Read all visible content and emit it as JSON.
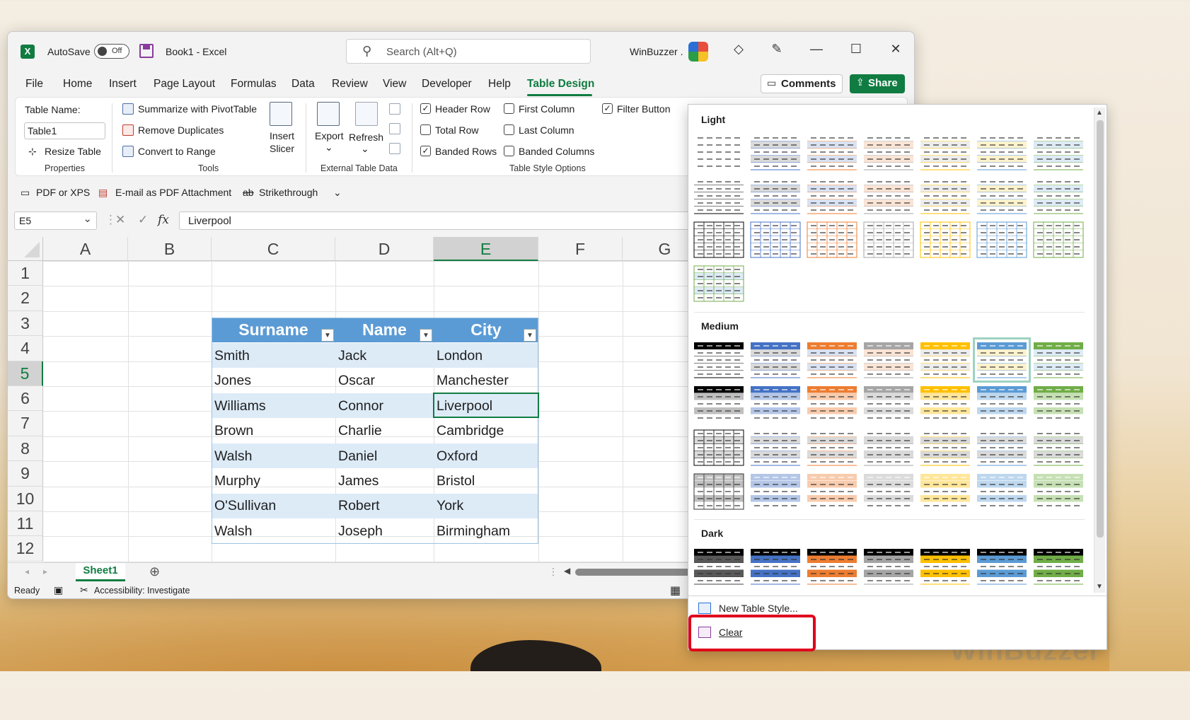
{
  "titlebar": {
    "autosave_label": "AutoSave",
    "autosave_state": "Off",
    "doc_title": "Book1  -  Excel",
    "search_placeholder": "Search (Alt+Q)",
    "user_name": "WinBuzzer ."
  },
  "menu": {
    "items": [
      "File",
      "Home",
      "Insert",
      "Page Layout",
      "Formulas",
      "Data",
      "Review",
      "View",
      "Developer",
      "Help",
      "Table Design"
    ],
    "active": "Table Design",
    "comments": "Comments",
    "share": "Share"
  },
  "ribbon": {
    "table_name_label": "Table Name:",
    "table_name_value": "Table1",
    "resize_table": "Resize Table",
    "properties_group": "Properties",
    "summarize_pivot": "Summarize with PivotTable",
    "remove_duplicates": "Remove Duplicates",
    "convert_range": "Convert to Range",
    "tools_group": "Tools",
    "insert_slicer_1": "Insert",
    "insert_slicer_2": "Slicer",
    "export": "Export",
    "refresh": "Refresh",
    "external_group": "External Table Data",
    "options": {
      "header_row": "Header Row",
      "total_row": "Total Row",
      "banded_rows": "Banded Rows",
      "first_column": "First Column",
      "last_column": "Last Column",
      "banded_columns": "Banded Columns",
      "filter_button": "Filter Button"
    },
    "checked": {
      "header_row": true,
      "total_row": false,
      "banded_rows": true,
      "first_column": false,
      "last_column": false,
      "banded_columns": false,
      "filter_button": true
    },
    "style_options_group": "Table Style Options"
  },
  "qat": {
    "pdf_xps": "PDF or XPS",
    "email_pdf": "E-mail as PDF Attachment",
    "strikethrough": "Strikethrough"
  },
  "formula": {
    "namebox": "E5",
    "fx": "fx",
    "value": "Liverpool"
  },
  "grid": {
    "columns": [
      "A",
      "B",
      "C",
      "D",
      "E",
      "F",
      "G"
    ],
    "rows": [
      "1",
      "2",
      "3",
      "4",
      "5",
      "6",
      "7",
      "8",
      "9",
      "10",
      "11",
      "12"
    ],
    "selected_column": "E",
    "selected_row": "5",
    "table_headers": [
      "Surname",
      "Name",
      "City"
    ],
    "table_rows": [
      [
        "Smith",
        "Jack",
        "London"
      ],
      [
        "Jones",
        "Oscar",
        "Manchester"
      ],
      [
        "Williams",
        "Connor",
        "Liverpool"
      ],
      [
        "Brown",
        "Charlie",
        "Cambridge"
      ],
      [
        "Walsh",
        "Daniel",
        "Oxford"
      ],
      [
        "Murphy",
        "James",
        "Bristol"
      ],
      [
        "O'Sullivan",
        "Robert",
        "York"
      ],
      [
        "Walsh",
        "Joseph",
        "Birmingham"
      ]
    ]
  },
  "sheet": {
    "tab": "Sheet1",
    "status_ready": "Ready",
    "accessibility": "Accessibility: Investigate"
  },
  "gallery": {
    "section_light": "Light",
    "section_medium": "Medium",
    "section_dark": "Dark",
    "new_style": "New Table Style...",
    "clear": "Clear",
    "colors": [
      "#000000",
      "#4472c4",
      "#ed7d31",
      "#a5a5a5",
      "#ffc000",
      "#5b9bd5",
      "#70ad47"
    ]
  },
  "watermark": "WinBuzzer"
}
